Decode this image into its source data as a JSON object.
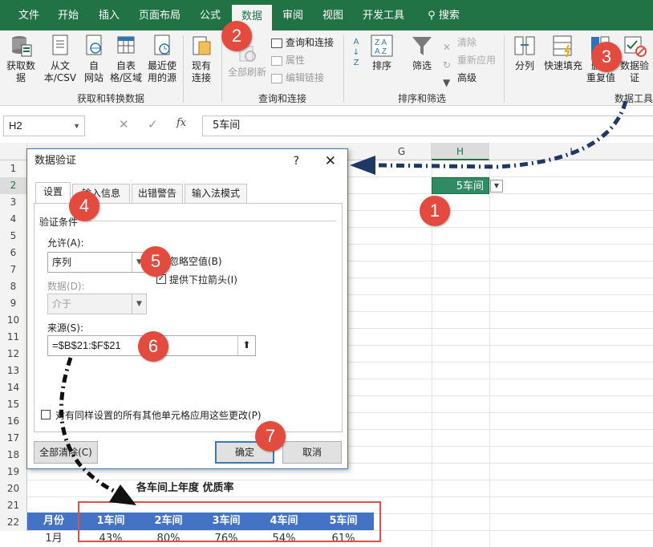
{
  "ribbon_tabs": [
    "文件",
    "开始",
    "插入",
    "页面布局",
    "公式",
    "数据",
    "审阅",
    "视图",
    "开发工具",
    "搜索"
  ],
  "ribbon": {
    "get_data": "获取数\n据",
    "from_text": "从文\n本/CSV",
    "from_web": "自\n网站",
    "from_table": "自表\n格/区域",
    "recent_sources": "最近使\n用的源",
    "existing_conn": "现有\n连接",
    "refresh_all": "全部刷新",
    "queries_conn": "查询和连接",
    "properties": "属性",
    "edit_links": "编辑链接",
    "sort_az": "A↓Z",
    "sort": "排序",
    "filter": "筛选",
    "clear": "清除",
    "reapply": "重新应用",
    "advanced": "高级",
    "split": "分列",
    "flash_fill": "快速填充",
    "remove_dup": "删除\n重复值",
    "data_validation": "数据验\n证",
    "group_get": "获取和转换数据",
    "group_query": "查询和连接",
    "group_sort": "排序和筛选",
    "group_tools": "数据工具"
  },
  "formula_bar": {
    "namebox": "H2",
    "fx": "fx",
    "content": "5车间"
  },
  "columns": [
    "G",
    "H",
    "I"
  ],
  "rows": [
    "1",
    "2",
    "3",
    "4",
    "5",
    "6",
    "7",
    "8",
    "9",
    "10",
    "11",
    "12",
    "13",
    "14",
    "15",
    "16",
    "17",
    "18",
    "19",
    "20",
    "21",
    "22"
  ],
  "cell_h2": "5车间",
  "dialog": {
    "title": "数据验证",
    "help": "?",
    "close": "✕",
    "tabs": [
      "设置",
      "输入信息",
      "出错警告",
      "输入法模式"
    ],
    "criteria_label": "验证条件",
    "allow_label": "允许(A):",
    "allow_value": "序列",
    "ignore_blank": "忽略空值(B)",
    "dropdown_arrow": "提供下拉箭头(I)",
    "data_label": "数据(D):",
    "data_value": "介于",
    "source_label": "来源(S):",
    "source_value": "=$B$21:$F$21",
    "apply_all": "对有同样设置的所有其他单元格应用这些更改(P)",
    "clear_all": "全部清除(C)",
    "ok": "确定",
    "cancel": "取消"
  },
  "table": {
    "caption": "各车间上年度  优质率",
    "header": [
      "月份",
      "1车间",
      "2车间",
      "3车间",
      "4车间",
      "5车间"
    ],
    "row1": [
      "1月",
      "43%",
      "80%",
      "76%",
      "54%",
      "61%"
    ]
  },
  "badges": [
    "1",
    "2",
    "3",
    "4",
    "5",
    "6",
    "7"
  ],
  "colors": {
    "excel_green": "#217346",
    "table_header": "#4472c4",
    "badge": "#e34b3f",
    "arrow": "#1f3864"
  }
}
